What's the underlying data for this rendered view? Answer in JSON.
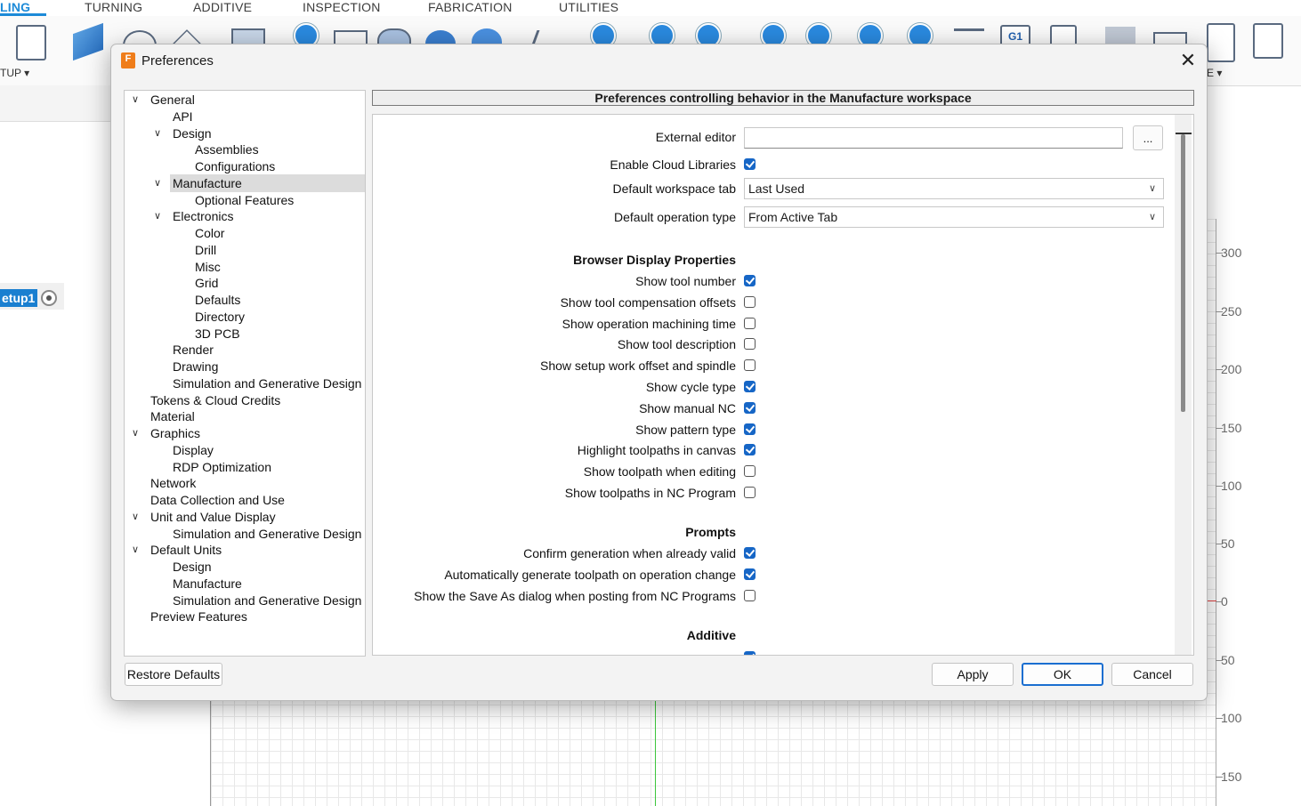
{
  "ribbon": {
    "tabs": [
      "LING",
      "TURNING",
      "ADDITIVE",
      "INSPECTION",
      "FABRICATION",
      "UTILITIES"
    ],
    "active_tab": "LING",
    "setup_label": "TUP ▾",
    "right_label": "E ▾",
    "g1_label": "G1"
  },
  "browser": {
    "setup_item": "etup1"
  },
  "ruler": {
    "labels": [
      "300",
      "250",
      "200",
      "150",
      "100",
      "50",
      "0",
      "50",
      "100",
      "150"
    ]
  },
  "dialog": {
    "title": "Preferences",
    "logo": "F",
    "close": "✕",
    "tree": [
      {
        "label": "General",
        "expanded": true
      },
      {
        "label": "API"
      },
      {
        "label": "Design",
        "expanded": true
      },
      {
        "label": "Assemblies"
      },
      {
        "label": "Configurations"
      },
      {
        "label": "Manufacture",
        "expanded": true,
        "selected": true
      },
      {
        "label": "Optional Features"
      },
      {
        "label": "Electronics",
        "expanded": true
      },
      {
        "label": "Color"
      },
      {
        "label": "Drill"
      },
      {
        "label": "Misc"
      },
      {
        "label": "Grid"
      },
      {
        "label": "Defaults"
      },
      {
        "label": "Directory"
      },
      {
        "label": "3D PCB"
      },
      {
        "label": "Render"
      },
      {
        "label": "Drawing"
      },
      {
        "label": "Simulation and Generative Design"
      },
      {
        "label": "Tokens & Cloud Credits"
      },
      {
        "label": "Material"
      },
      {
        "label": "Graphics",
        "expanded": true
      },
      {
        "label": "Display"
      },
      {
        "label": "RDP Optimization"
      },
      {
        "label": "Network"
      },
      {
        "label": "Data Collection and Use"
      },
      {
        "label": "Unit and Value Display",
        "expanded": true
      },
      {
        "label": "Simulation and Generative Design"
      },
      {
        "label": "Default Units",
        "expanded": true
      },
      {
        "label": "Design"
      },
      {
        "label": "Manufacture"
      },
      {
        "label": "Simulation and Generative Design"
      },
      {
        "label": "Preview Features"
      }
    ],
    "panel_header": "Preferences controlling behavior in the Manufacture workspace",
    "external_editor": {
      "label": "External editor",
      "value": "",
      "browse": "..."
    },
    "enable_cloud_libraries": {
      "label": "Enable Cloud Libraries",
      "checked": true
    },
    "default_workspace_tab": {
      "label": "Default workspace tab",
      "value": "Last Used"
    },
    "default_operation_type": {
      "label": "Default operation type",
      "value": "From Active Tab"
    },
    "browser_section": "Browser Display Properties",
    "browser_options": [
      {
        "label": "Show tool number",
        "checked": true
      },
      {
        "label": "Show tool compensation offsets",
        "checked": false
      },
      {
        "label": "Show operation machining time",
        "checked": false
      },
      {
        "label": "Show tool description",
        "checked": false
      },
      {
        "label": "Show setup work offset and spindle",
        "checked": false
      },
      {
        "label": "Show cycle type",
        "checked": true
      },
      {
        "label": "Show manual NC",
        "checked": true
      },
      {
        "label": "Show pattern type",
        "checked": true
      },
      {
        "label": "Highlight toolpaths in canvas",
        "checked": true
      },
      {
        "label": "Show toolpath when editing",
        "checked": false
      },
      {
        "label": "Show toolpaths in NC Program",
        "checked": false
      }
    ],
    "prompts_section": "Prompts",
    "prompt_options": [
      {
        "label": "Confirm generation when already valid",
        "checked": true
      },
      {
        "label": "Automatically generate toolpath on operation change",
        "checked": true
      },
      {
        "label": "Show the Save As dialog when posting from NC Programs",
        "checked": false
      }
    ],
    "additive_section": "Additive",
    "buttons": {
      "restore": "Restore Defaults",
      "apply": "Apply",
      "ok": "OK",
      "cancel": "Cancel"
    }
  }
}
